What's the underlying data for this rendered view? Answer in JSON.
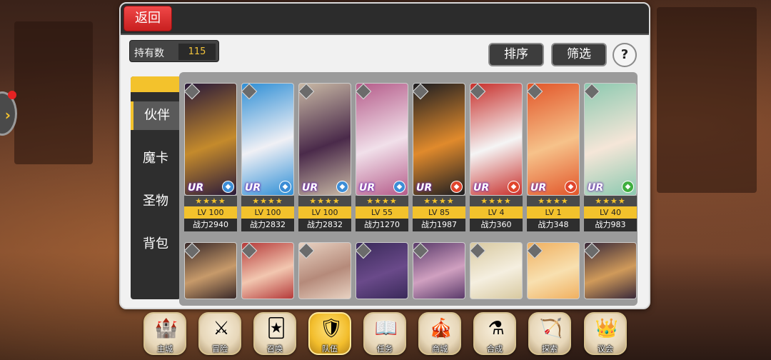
{
  "header": {
    "back_label": "返回"
  },
  "owned": {
    "label": "持有数",
    "value": "115"
  },
  "toolbar": {
    "sort_label": "排序",
    "filter_label": "筛选",
    "help_label": "?"
  },
  "side_tabs": [
    {
      "label": "伙伴",
      "active": true
    },
    {
      "label": "魔卡",
      "active": false
    },
    {
      "label": "圣物",
      "active": false
    },
    {
      "label": "背包",
      "active": false
    }
  ],
  "cards_row1": [
    {
      "rarity": "UR",
      "stars": "★★★★",
      "level": "LV 100",
      "power": "战力2940",
      "palette": [
        "#2a1a3a",
        "#c48a2c"
      ],
      "element_color": "#3c8dd6",
      "element_icon": "water-icon"
    },
    {
      "rarity": "UR",
      "stars": "★★★★",
      "level": "LV 100",
      "power": "战力2832",
      "palette": [
        "#2f8fd6",
        "#f0f0f5"
      ],
      "element_color": "#3c8dd6",
      "element_icon": "water-icon"
    },
    {
      "rarity": "UR",
      "stars": "★★★★",
      "level": "LV 100",
      "power": "战力2832",
      "palette": [
        "#c9b9a5",
        "#4a2a4a"
      ],
      "element_color": "#3c8dd6",
      "element_icon": "water-icon"
    },
    {
      "rarity": "UR",
      "stars": "★★★★",
      "level": "LV 55",
      "power": "战力1270",
      "palette": [
        "#b55c8a",
        "#f1e0ea"
      ],
      "element_color": "#3c8dd6",
      "element_icon": "water-icon"
    },
    {
      "rarity": "UR",
      "stars": "★★★★",
      "level": "LV 85",
      "power": "战力1987",
      "palette": [
        "#1d1d22",
        "#e08a2c"
      ],
      "element_color": "#e0452c",
      "element_icon": "fire-icon"
    },
    {
      "rarity": "UR",
      "stars": "★★★★",
      "level": "LV 4",
      "power": "战力360",
      "palette": [
        "#c8302c",
        "#f5f5f5"
      ],
      "element_color": "#e0452c",
      "element_icon": "fire-icon"
    },
    {
      "rarity": "UR",
      "stars": "★★★★",
      "level": "LV 1",
      "power": "战力348",
      "palette": [
        "#e2562a",
        "#f6c28a"
      ],
      "element_color": "#e0452c",
      "element_icon": "fire-icon"
    },
    {
      "rarity": "UR",
      "stars": "★★★★",
      "level": "LV 40",
      "power": "战力983",
      "palette": [
        "#8cc9b0",
        "#f5e6d8"
      ],
      "element_color": "#3fae3f",
      "element_icon": "wind-icon"
    }
  ],
  "cards_row2": [
    {
      "palette": [
        "#3a2a2a",
        "#c79a6a"
      ]
    },
    {
      "palette": [
        "#b53a3a",
        "#f2c7b0"
      ]
    },
    {
      "palette": [
        "#e8d2c2",
        "#b58a7a"
      ]
    },
    {
      "palette": [
        "#3a2a5a",
        "#6a4a8a"
      ]
    },
    {
      "palette": [
        "#5a3a6a",
        "#d0a0c0"
      ]
    },
    {
      "palette": [
        "#d8c9a0",
        "#f5efe0"
      ]
    },
    {
      "palette": [
        "#f0b060",
        "#f8e0b0"
      ]
    },
    {
      "palette": [
        "#3a2a3a",
        "#d09a5a"
      ]
    }
  ],
  "bottom_nav": [
    {
      "label": "主城",
      "icon": "castle-icon",
      "glyph": "🏰",
      "active": false
    },
    {
      "label": "冒险",
      "icon": "crossed-swords-icon",
      "glyph": "⚔",
      "active": false
    },
    {
      "label": "召唤",
      "icon": "summon-card-icon",
      "glyph": "🃏",
      "active": false
    },
    {
      "label": "队伍",
      "icon": "team-crest-icon",
      "glyph": "🛡",
      "active": true
    },
    {
      "label": "任务",
      "icon": "quest-book-icon",
      "glyph": "📖",
      "active": false
    },
    {
      "label": "商城",
      "icon": "shop-tent-icon",
      "glyph": "🎪",
      "active": false
    },
    {
      "label": "合成",
      "icon": "potion-flask-icon",
      "glyph": "⚗",
      "active": false
    },
    {
      "label": "探索",
      "icon": "bow-arrow-icon",
      "glyph": "🏹",
      "active": false
    },
    {
      "label": "议会",
      "icon": "council-crown-icon",
      "glyph": "👑",
      "active": false
    }
  ]
}
